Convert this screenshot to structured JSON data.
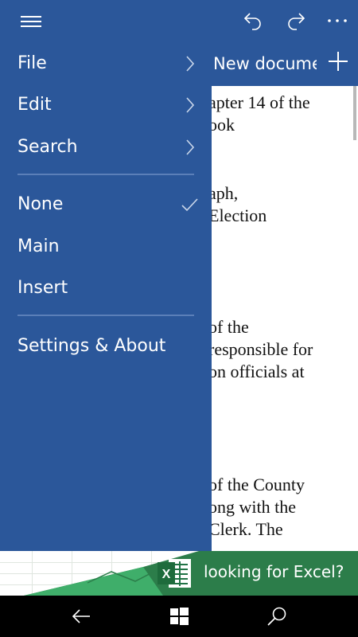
{
  "appbar": {
    "icons": [
      "undo-icon",
      "redo-icon",
      "more-icon"
    ]
  },
  "new_document": {
    "label": "New documer",
    "icon": "plus-icon"
  },
  "document": {
    "lines": [
      "apter 14 of the",
      "ook",
      "",
      "aph,",
      "Election",
      "",
      "",
      "of the",
      " responsible for",
      "on officials at",
      "",
      "",
      "of the County",
      "ong with the",
      " Clerk.  The"
    ]
  },
  "menu": {
    "group1": [
      {
        "label": "File",
        "icon": "chevron-right-icon"
      },
      {
        "label": "Edit",
        "icon": "chevron-right-icon"
      },
      {
        "label": "Search",
        "icon": "chevron-right-icon"
      }
    ],
    "group2": [
      {
        "label": "None",
        "icon": "check-icon",
        "checked": true
      },
      {
        "label": "Main"
      },
      {
        "label": "Insert"
      }
    ],
    "group3": [
      {
        "label": "Settings & About"
      }
    ]
  },
  "banner": {
    "text": "looking for Excel?",
    "icon": "excel-icon"
  },
  "navbar": {
    "icons": [
      "back-icon",
      "windows-icon",
      "search-icon"
    ]
  },
  "colors": {
    "accent": "#2b579a",
    "banner": "#2c7d4a",
    "navbar": "#000000"
  }
}
